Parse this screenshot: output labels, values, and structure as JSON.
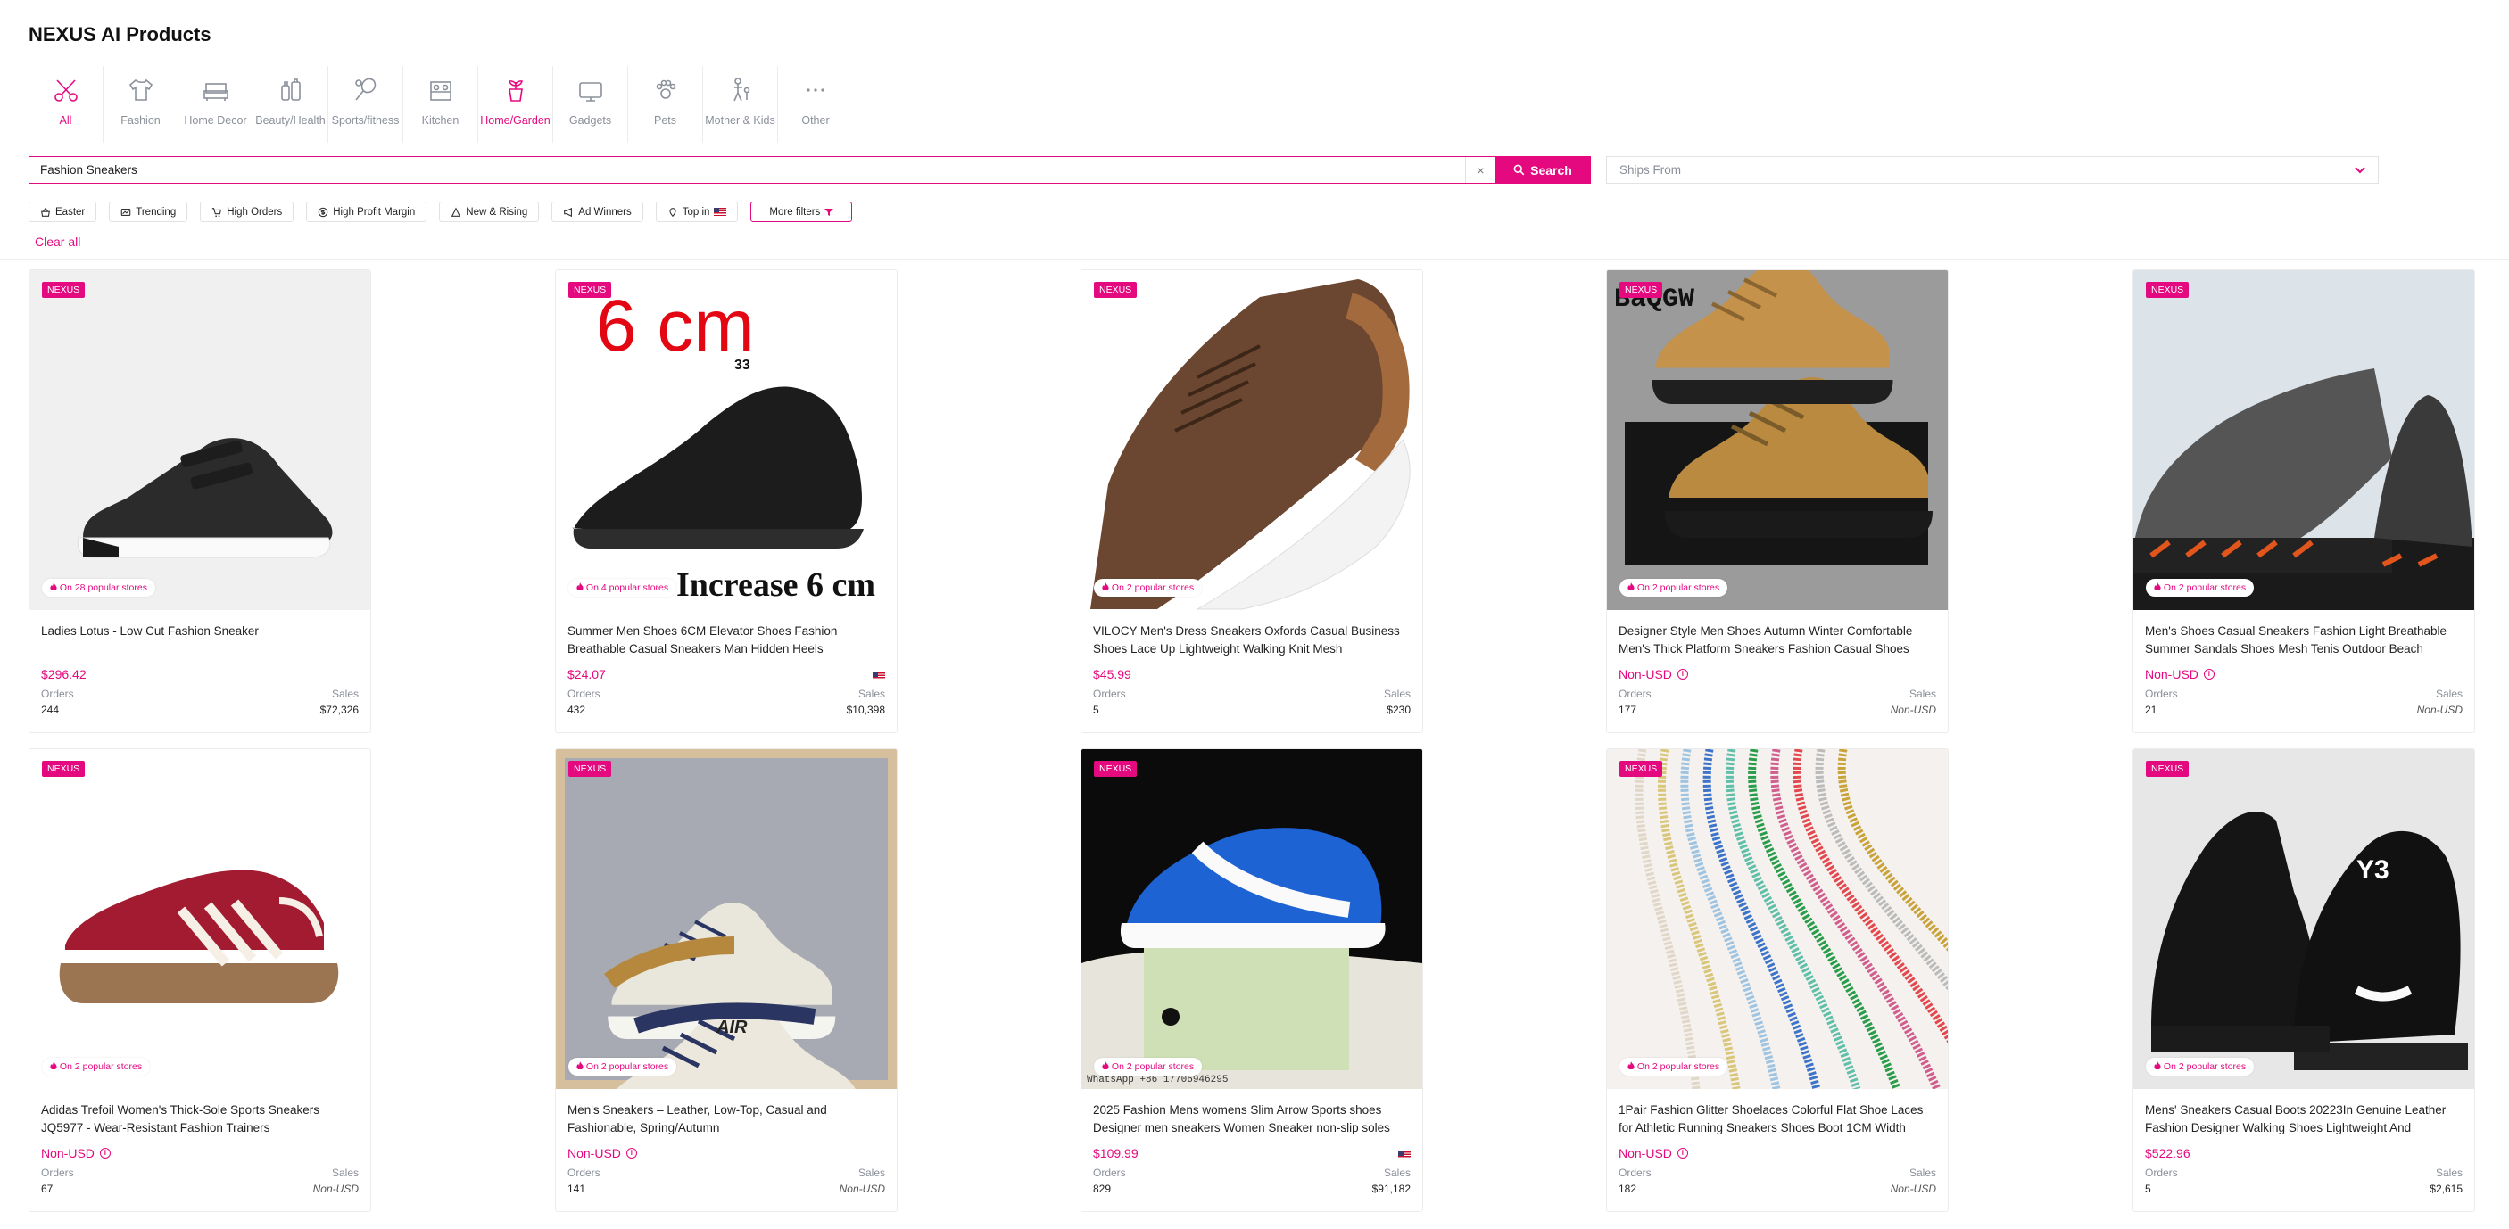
{
  "page": {
    "title": "NEXUS AI Products"
  },
  "categories": [
    {
      "label": "All",
      "icon": "scissors-tools-icon",
      "active": true
    },
    {
      "label": "Fashion",
      "icon": "shirt-icon",
      "active": false
    },
    {
      "label": "Home Decor",
      "icon": "sofa-icon",
      "active": false
    },
    {
      "label": "Beauty/Health",
      "icon": "bottles-icon",
      "active": false
    },
    {
      "label": "Sports/fitness",
      "icon": "racket-icon",
      "active": false
    },
    {
      "label": "Kitchen",
      "icon": "stove-icon",
      "active": false
    },
    {
      "label": "Home/Garden",
      "icon": "plant-pot-icon",
      "active": true
    },
    {
      "label": "Gadgets",
      "icon": "device-icon",
      "active": false
    },
    {
      "label": "Pets",
      "icon": "paw-icon",
      "active": false
    },
    {
      "label": "Mother & Kids",
      "icon": "mother-child-icon",
      "active": false
    },
    {
      "label": "Other",
      "icon": "more-dots-icon",
      "active": false
    }
  ],
  "search": {
    "value": "Fashion Sneakers",
    "clear": "×",
    "button": "Search"
  },
  "ships_from": {
    "placeholder": "Ships From"
  },
  "filters": [
    {
      "label": "Easter",
      "icon": "basket-icon"
    },
    {
      "label": "Trending",
      "icon": "trending-icon"
    },
    {
      "label": "High Orders",
      "icon": "cart-icon"
    },
    {
      "label": "High Profit Margin",
      "icon": "dollar-circle-icon"
    },
    {
      "label": "New & Rising",
      "icon": "rising-icon"
    },
    {
      "label": "Ad Winners",
      "icon": "megaphone-icon"
    },
    {
      "label": "Top in",
      "icon": "pin-icon",
      "flag": true
    }
  ],
  "more_filters": "More filters",
  "clear_all": "Clear all",
  "labels": {
    "badge": "NEXUS",
    "orders": "Orders",
    "sales": "Sales"
  },
  "colors": {
    "accent": "#e5097f",
    "muted": "#8a8f99"
  },
  "products": [
    {
      "title": "Ladies Lotus - Low Cut Fashion Sneaker",
      "price": "$296.42",
      "orders": "244",
      "sales": "$72,326",
      "stores": "On 28 popular stores",
      "flag": false,
      "img": "black-sneaker",
      "price_info": false
    },
    {
      "title": "Summer Men Shoes 6CM Elevator Shoes Fashion Breathable Casual Sneakers Man Hidden Heels",
      "price": "$24.07",
      "orders": "432",
      "sales": "$10,398",
      "stores": "On 4 popular stores",
      "flag": true,
      "img": "elevator-sneaker",
      "img_text_top": "6 cm",
      "img_text_bottom": "Increase 6 cm",
      "price_info": false
    },
    {
      "title": "VILOCY Men's Dress Sneakers Oxfords Casual Business Shoes Lace Up Lightweight Walking Knit Mesh",
      "price": "$45.99",
      "orders": "5",
      "sales": "$230",
      "stores": "On 2 popular stores",
      "flag": false,
      "img": "brown-knit",
      "price_info": false
    },
    {
      "title": "Designer Style Men Shoes Autumn Winter Comfortable Men's Thick Platform Sneakers Fashion Casual Shoes",
      "price": "Non-USD",
      "orders": "177",
      "sales": "Non-USD",
      "stores": "On 2 popular stores",
      "flag": false,
      "img": "tan-platform",
      "img_text_top": "BaQGW",
      "price_info": true
    },
    {
      "title": "Men's Shoes Casual Sneakers Fashion Light Breathable Summer Sandals Shoes Mesh Tenis Outdoor Beach",
      "price": "Non-USD",
      "orders": "21",
      "sales": "Non-USD",
      "stores": "On 2 popular stores",
      "flag": false,
      "img": "grey-runner",
      "price_info": true
    },
    {
      "title": "Adidas Trefoil Women's Thick-Sole Sports Sneakers JQ5977 - Wear-Resistant Fashion Trainers",
      "price": "Non-USD",
      "orders": "67",
      "sales": "Non-USD",
      "stores": "On 2 popular stores",
      "flag": false,
      "img": "red-suede",
      "price_info": true
    },
    {
      "title": "Men's Sneakers – Leather, Low-Top, Casual and Fashionable, Spring/Autumn",
      "price": "Non-USD",
      "orders": "141",
      "sales": "Non-USD",
      "stores": "On 2 popular stores",
      "flag": false,
      "img": "navy-tan",
      "img_text_top": "AIR",
      "price_info": true
    },
    {
      "title": "2025 Fashion Mens womens Slim Arrow Sports shoes Designer men sneakers Women Sneaker non-slip soles",
      "price": "$109.99",
      "orders": "829",
      "sales": "$91,182",
      "stores": "On 2 popular stores",
      "flag": true,
      "img": "blue-white",
      "img_text_bottom": "WhatsApp +86 17706946295",
      "price_info": false
    },
    {
      "title": "1Pair Fashion Glitter Shoelaces Colorful Flat Shoe Laces for Athletic Running Sneakers Shoes Boot 1CM Width",
      "price": "Non-USD",
      "orders": "182",
      "sales": "Non-USD",
      "stores": "On 2 popular stores",
      "flag": false,
      "img": "laces",
      "price_info": true
    },
    {
      "title": "Mens' Sneakers Casual Boots 20223In Genuine Leather Fashion Designer Walking Shoes Lightweight And",
      "price": "$522.96",
      "orders": "5",
      "sales": "$2,615",
      "stores": "On 2 popular stores",
      "flag": false,
      "img": "y3-black",
      "img_text_top": "Y3",
      "price_info": false
    }
  ]
}
